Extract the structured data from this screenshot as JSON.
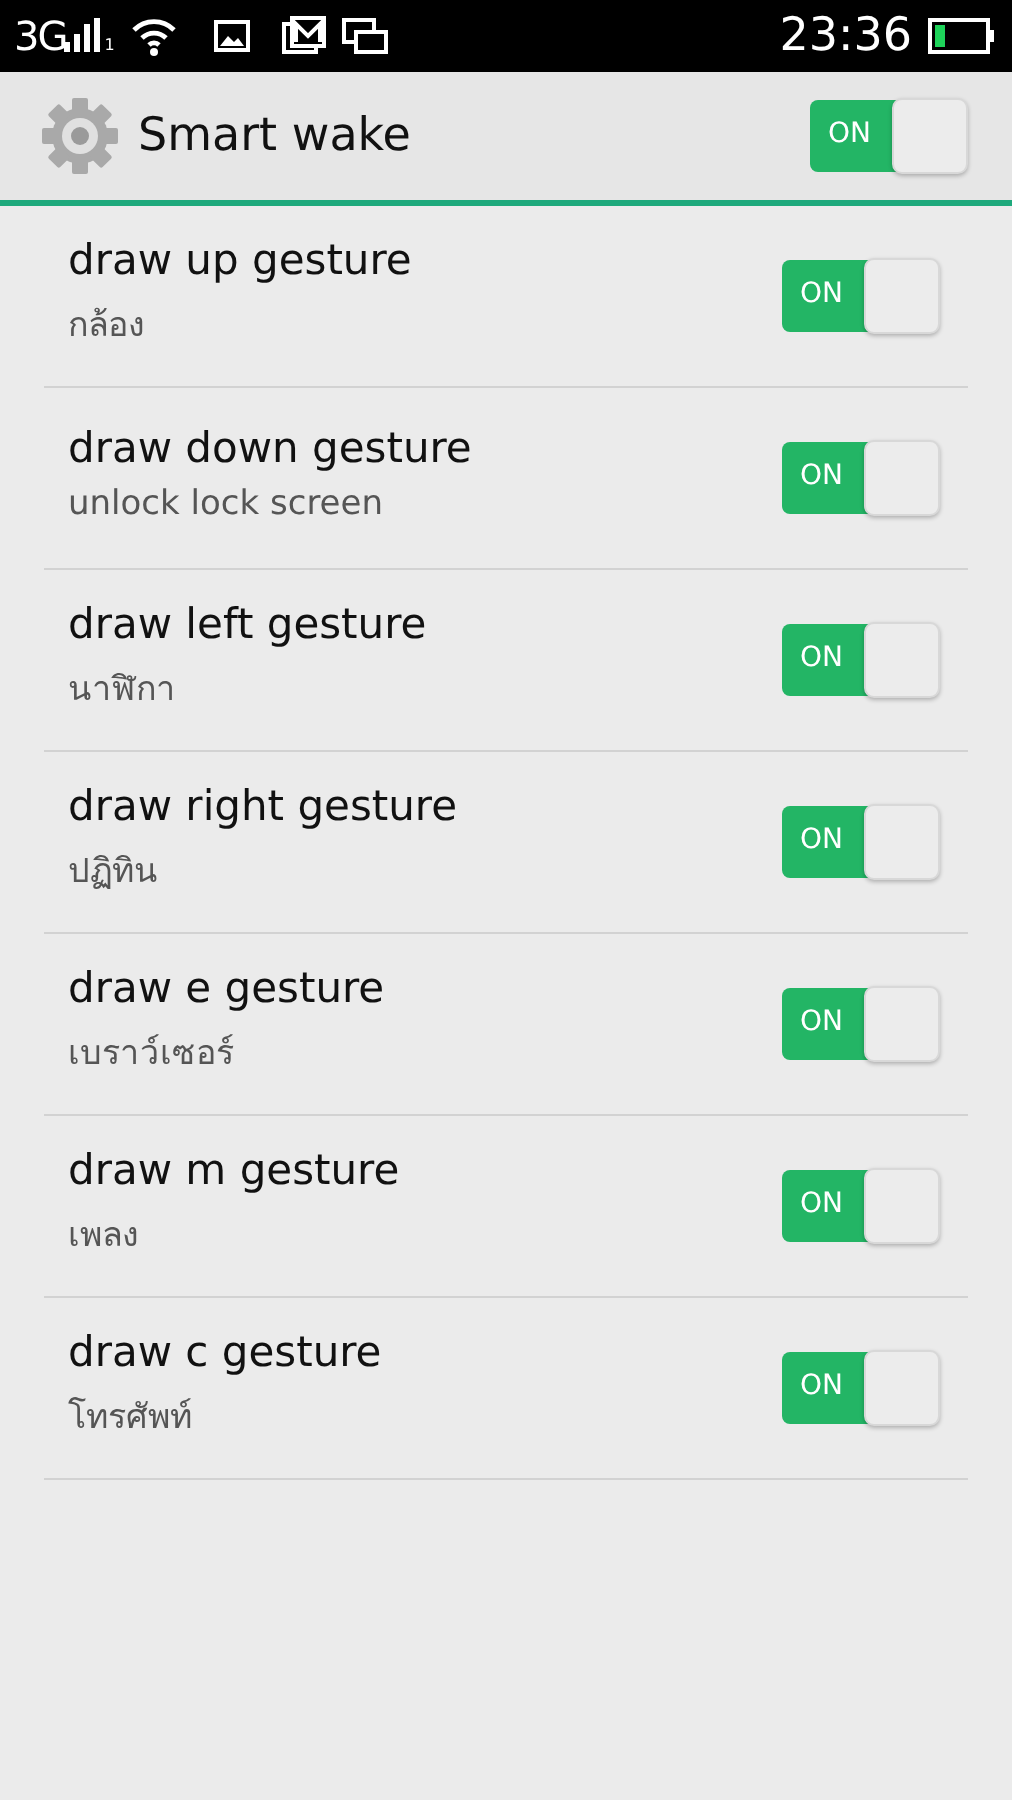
{
  "status_bar": {
    "network": "3G",
    "sim": "1",
    "time": "23:36"
  },
  "header": {
    "title": "Smart wake",
    "toggle": {
      "on": true,
      "label": "ON"
    }
  },
  "gestures": [
    {
      "title": "draw up gesture",
      "subtitle": "กล้อง",
      "toggle": {
        "on": true,
        "label": "ON"
      }
    },
    {
      "title": "draw down gesture",
      "subtitle": "unlock lock screen",
      "toggle": {
        "on": true,
        "label": "ON"
      }
    },
    {
      "title": "draw left gesture",
      "subtitle": "นาฬิกา",
      "toggle": {
        "on": true,
        "label": "ON"
      }
    },
    {
      "title": "draw right gesture",
      "subtitle": "ปฏิทิน",
      "toggle": {
        "on": true,
        "label": "ON"
      }
    },
    {
      "title": "draw e gesture",
      "subtitle": "เบราว์เซอร์",
      "toggle": {
        "on": true,
        "label": "ON"
      }
    },
    {
      "title": "draw m gesture",
      "subtitle": "เพลง",
      "toggle": {
        "on": true,
        "label": "ON"
      }
    },
    {
      "title": "draw c gesture",
      "subtitle": "โทรศัพท์",
      "toggle": {
        "on": true,
        "label": "ON"
      }
    }
  ]
}
